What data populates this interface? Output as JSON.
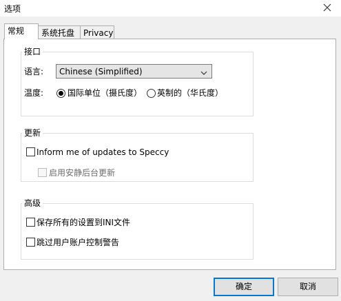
{
  "window": {
    "title": "选项"
  },
  "tabs": [
    {
      "label": "常规",
      "active": true
    },
    {
      "label": "系统托盘",
      "active": false
    },
    {
      "label": "Privacy",
      "active": false
    }
  ],
  "interface": {
    "group_label": "接口",
    "language_label": "语言:",
    "language_value": "Chinese (Simplified)",
    "temperature_label": "温度:",
    "temp_options": [
      {
        "label": "国际单位（摄氏度）",
        "checked": true
      },
      {
        "label": "英制的（华氏度）",
        "checked": false
      }
    ]
  },
  "updates": {
    "group_label": "更新",
    "inform_label": "Inform me of updates to Speccy",
    "inform_checked": false,
    "silent_label": "启用安静后台更新",
    "silent_checked": false,
    "silent_enabled": false
  },
  "advanced": {
    "group_label": "高级",
    "save_ini_label": "保存所有的设置到INI文件",
    "save_ini_checked": false,
    "skip_uac_label": "跳过用户账户控制警告",
    "skip_uac_checked": false
  },
  "buttons": {
    "ok": "确定",
    "cancel": "取消"
  }
}
